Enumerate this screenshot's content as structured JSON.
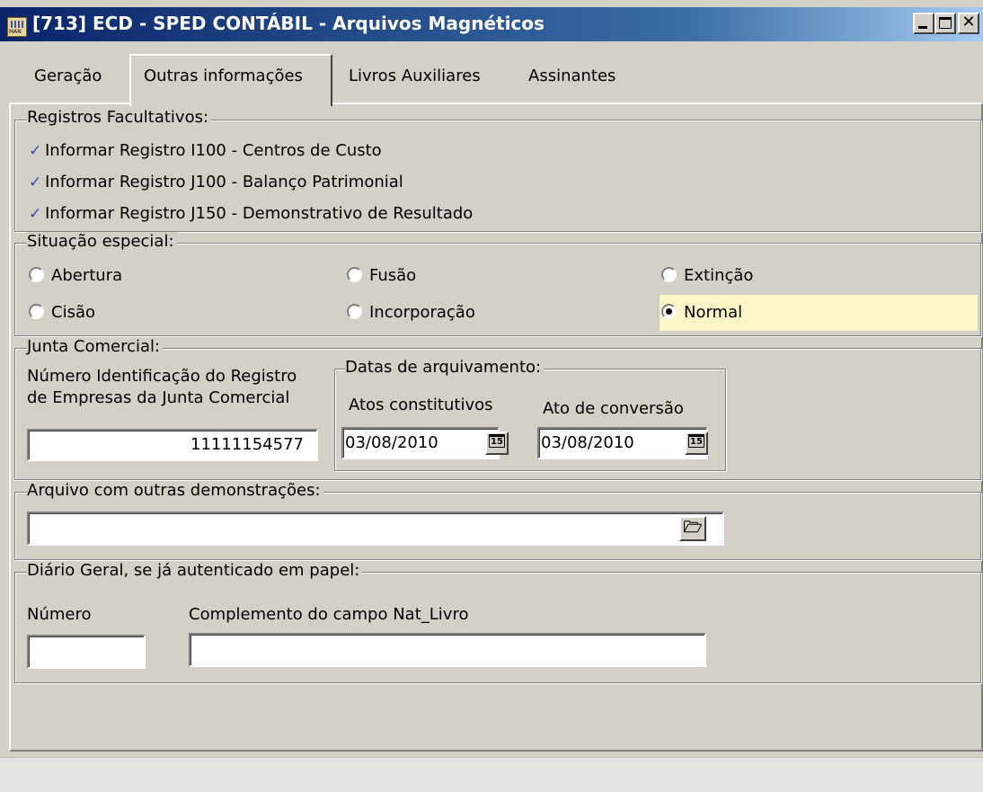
{
  "window": {
    "title": "[713] ECD - SPED CONTÁBIL  - Arquivos Magnéticos",
    "app_icon": "man-app-icon",
    "app_icon_label": "MAN"
  },
  "tabs": [
    {
      "label": "Geração",
      "active": false
    },
    {
      "label": "Outras informações",
      "active": true
    },
    {
      "label": "Livros Auxiliares",
      "active": false
    },
    {
      "label": "Assinantes",
      "active": false
    }
  ],
  "registros": {
    "legend": "Registros Facultativos:",
    "items": [
      {
        "label": "Informar Registro I100 - Centros de Custo",
        "checked": true
      },
      {
        "label": "Informar Registro J100 - Balanço Patrimonial",
        "checked": true
      },
      {
        "label": "Informar Registro J150 - Demonstrativo de Resultado",
        "checked": true
      }
    ]
  },
  "situacao": {
    "legend": "Situação especial:",
    "options": [
      {
        "label": "Abertura",
        "selected": false
      },
      {
        "label": "Fusão",
        "selected": false
      },
      {
        "label": "Extinção",
        "selected": false
      },
      {
        "label": "Cisão",
        "selected": false
      },
      {
        "label": "Incorporação",
        "selected": false
      },
      {
        "label": "Normal",
        "selected": true
      }
    ],
    "highlight_color": "#fbf5c8"
  },
  "junta": {
    "legend": "Junta Comercial:",
    "numero_label_1": "Número Identificação do Registro",
    "numero_label_2": "de Empresas da Junta Comercial",
    "numero_value": "11111154577",
    "datas_legend": "Datas de arquivamento:",
    "atos_label": "Atos constitutivos",
    "atos_value": "03/08/2010",
    "conversao_label": "Ato de conversão",
    "conversao_value": "03/08/2010",
    "calendar_icon_text": "15"
  },
  "arquivo": {
    "legend": "Arquivo com outras demonstrações:",
    "value": ""
  },
  "diario": {
    "legend": "Diário Geral, se já autenticado em papel:",
    "numero_label": "Número",
    "numero_value": "",
    "complemento_label": "Complemento do campo Nat_Livro",
    "complemento_value": ""
  }
}
